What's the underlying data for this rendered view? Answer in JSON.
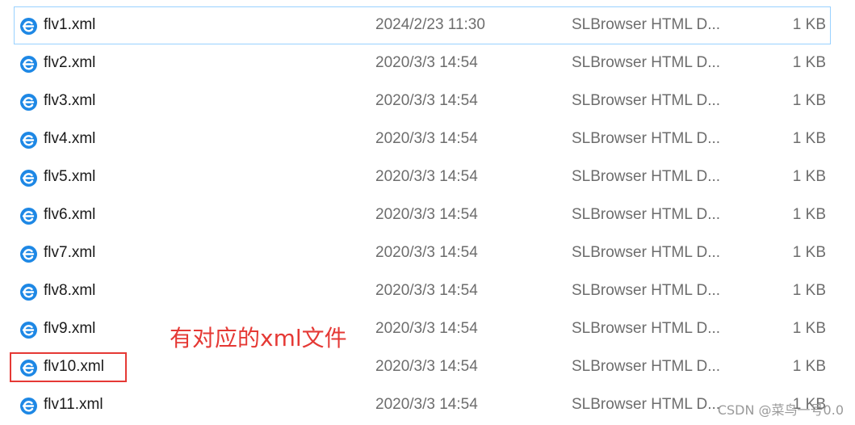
{
  "files": [
    {
      "name": "flv1.xml",
      "date": "2024/2/23 11:30",
      "type": "SLBrowser HTML D...",
      "size": "1 KB",
      "icon": "browser-file-icon",
      "selected": true
    },
    {
      "name": "flv2.xml",
      "date": "2020/3/3 14:54",
      "type": "SLBrowser HTML D...",
      "size": "1 KB",
      "icon": "browser-file-icon"
    },
    {
      "name": "flv3.xml",
      "date": "2020/3/3 14:54",
      "type": "SLBrowser HTML D...",
      "size": "1 KB",
      "icon": "browser-file-icon"
    },
    {
      "name": "flv4.xml",
      "date": "2020/3/3 14:54",
      "type": "SLBrowser HTML D...",
      "size": "1 KB",
      "icon": "browser-file-icon"
    },
    {
      "name": "flv5.xml",
      "date": "2020/3/3 14:54",
      "type": "SLBrowser HTML D...",
      "size": "1 KB",
      "icon": "browser-file-icon"
    },
    {
      "name": "flv6.xml",
      "date": "2020/3/3 14:54",
      "type": "SLBrowser HTML D...",
      "size": "1 KB",
      "icon": "browser-file-icon"
    },
    {
      "name": "flv7.xml",
      "date": "2020/3/3 14:54",
      "type": "SLBrowser HTML D...",
      "size": "1 KB",
      "icon": "browser-file-icon"
    },
    {
      "name": "flv8.xml",
      "date": "2020/3/3 14:54",
      "type": "SLBrowser HTML D...",
      "size": "1 KB",
      "icon": "browser-file-icon"
    },
    {
      "name": "flv9.xml",
      "date": "2020/3/3 14:54",
      "type": "SLBrowser HTML D...",
      "size": "1 KB",
      "icon": "browser-file-icon"
    },
    {
      "name": "flv10.xml",
      "date": "2020/3/3 14:54",
      "type": "SLBrowser HTML D...",
      "size": "1 KB",
      "icon": "browser-file-icon"
    },
    {
      "name": "flv11.xml",
      "date": "2020/3/3 14:54",
      "type": "SLBrowser HTML D...",
      "size": "1 KB",
      "icon": "browser-file-icon"
    }
  ],
  "annotation": {
    "text": "有对应的xml文件",
    "color": "#e53935"
  },
  "watermark": "CSDN @菜鸟一号0.0",
  "colors": {
    "selection_border": "#99d1ff",
    "icon_blue": "#1e88e5",
    "secondary_text": "#6d6d6d"
  }
}
